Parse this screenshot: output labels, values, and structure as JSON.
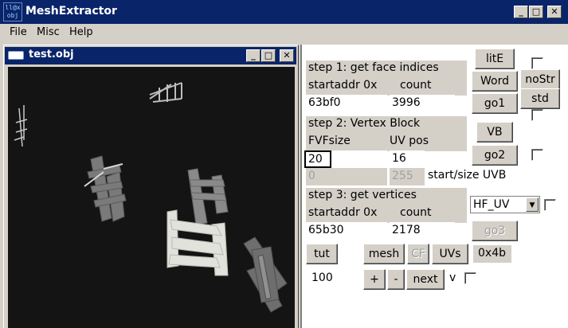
{
  "app": {
    "title": "MeshExtractor",
    "icon_text": "ll@x\nobj",
    "controls": {
      "minimize": "_",
      "maximize": "□",
      "close": "✕"
    }
  },
  "menu": {
    "file": "File",
    "misc": "Misc",
    "help": "Help"
  },
  "child_window": {
    "title": "test.obj",
    "controls": {
      "minimize": "_",
      "maximize": "□",
      "close": "✕"
    }
  },
  "step1": {
    "title": "step 1: get face indices",
    "startaddr_label": "startaddr 0x",
    "count_label": "count",
    "startaddr_value": "63bf0",
    "count_value": "3996",
    "buttons": {
      "litE": "litE",
      "word": "Word",
      "go1": "go1",
      "nostr": "noStr",
      "std": "std"
    }
  },
  "step2": {
    "title": "step 2: Vertex Block",
    "fvfsize_label": "FVFsize",
    "uvpos_label": "UV pos",
    "fvfsize_value": "20",
    "uvpos_value": "16",
    "uvb_start_value": "0",
    "uvb_size_value": "255",
    "uvb_label": "start/size UVB",
    "buttons": {
      "vb": "VB",
      "go2": "go2"
    }
  },
  "step3": {
    "title": "step 3: get vertices",
    "startaddr_label": "startaddr 0x",
    "count_label": "count",
    "startaddr_value": "65b30",
    "count_value": "2178",
    "uv_mode": "HF_UV",
    "buttons": {
      "go3": "go3"
    }
  },
  "bottom": {
    "tut": "tut",
    "mesh": "mesh",
    "cf": "CF",
    "uvs": "UVs",
    "hex_readout": "0x4b",
    "step_value": "100",
    "plus": "+",
    "minus": "-",
    "next": "next",
    "v": "v"
  },
  "colors": {
    "titlebar": "#0a246a",
    "face": "#d4d0c8",
    "viewport": "#141414",
    "mesh": "#8a8a8a",
    "mesh_highlight": "#e6e6e0"
  }
}
